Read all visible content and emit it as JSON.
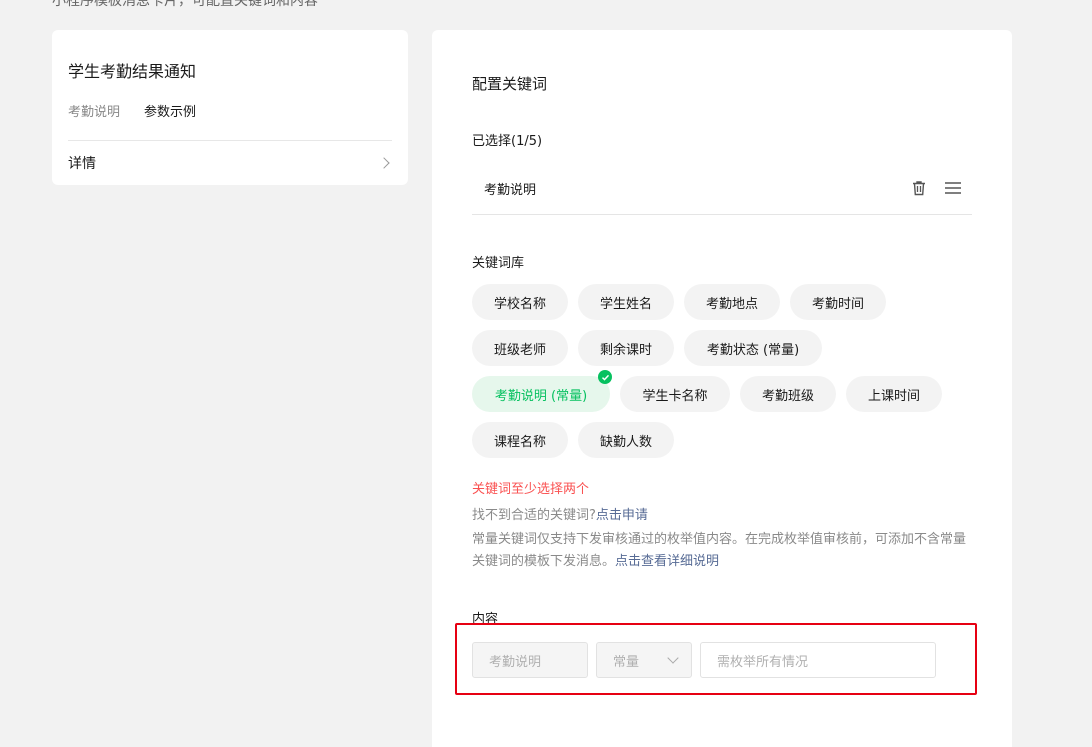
{
  "top_cut_text": "小程序模板消息卡片，可配置关键词和内容",
  "left_card": {
    "title": "学生考勤结果通知",
    "tabs": [
      "考勤说明",
      "参数示例"
    ],
    "detail_label": "详情"
  },
  "right_card": {
    "config_title": "配置关键词",
    "selected_label": "已选择(1/5)",
    "selected_items": [
      "考勤说明"
    ],
    "library_label": "关键词库",
    "keyword_rows": [
      [
        {
          "label": "学校名称"
        },
        {
          "label": "学生姓名"
        },
        {
          "label": "考勤地点"
        },
        {
          "label": "考勤时间"
        }
      ],
      [
        {
          "label": "班级老师"
        },
        {
          "label": "剩余课时"
        },
        {
          "label": "考勤状态 (常量)"
        }
      ],
      [
        {
          "label": "考勤说明 (常量)",
          "selected": true
        },
        {
          "label": "学生卡名称"
        },
        {
          "label": "考勤班级"
        },
        {
          "label": "上课时间"
        }
      ],
      [
        {
          "label": "课程名称"
        },
        {
          "label": "缺勤人数"
        }
      ]
    ],
    "error_hint": "关键词至少选择两个",
    "not_found_prefix": "找不到合适的关键词?",
    "not_found_link": "点击申请",
    "constant_note": "常量关键词仅支持下发审核通过的枚举值内容。在完成枚举值审核前，可添加不含常量关键词的模板下发消息。",
    "constant_note_link": "点击查看详细说明",
    "content_label": "内容",
    "content_row": {
      "keyword": "考勤说明",
      "type_select": "常量",
      "input_placeholder": "需枚举所有情况"
    }
  },
  "colors": {
    "accent_green": "#07c160",
    "error_red": "#fa5151",
    "link_blue": "#576b95",
    "highlight_red": "#e60012"
  }
}
